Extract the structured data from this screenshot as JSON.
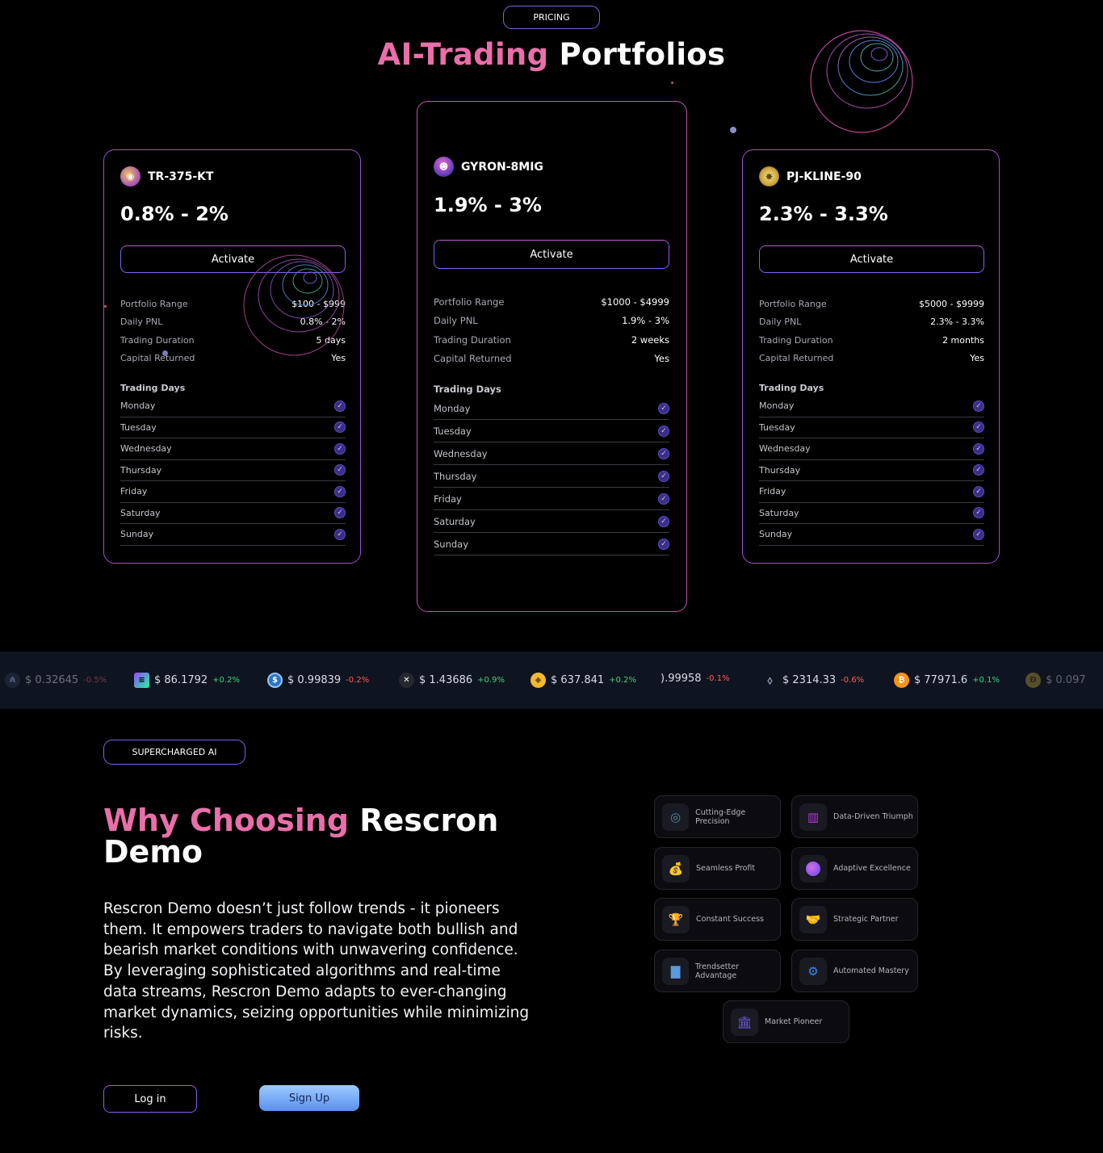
{
  "pricing": {
    "pill": "PRICING",
    "heading_accent": "AI-Trading",
    "heading_rest": "Portfolios"
  },
  "cards": [
    {
      "name": "TR-375-KT",
      "rate": "0.8% - 2%",
      "activate_label": "Activate",
      "details": [
        {
          "k": "Portfolio Range",
          "v": "$100 - $999"
        },
        {
          "k": "Daily PNL",
          "v": "0.8% - 2%"
        },
        {
          "k": "Trading Duration",
          "v": "5 days"
        },
        {
          "k": "Capital Returned",
          "v": "Yes"
        }
      ]
    },
    {
      "name": "GYRON-8MIG",
      "rate": "1.9% - 3%",
      "activate_label": "Activate",
      "details": [
        {
          "k": "Portfolio Range",
          "v": "$1000 - $4999"
        },
        {
          "k": "Daily PNL",
          "v": "1.9% - 3%"
        },
        {
          "k": "Trading Duration",
          "v": "2 weeks"
        },
        {
          "k": "Capital Returned",
          "v": "Yes"
        }
      ]
    },
    {
      "name": "PJ-KLINE-90",
      "rate": "2.3% - 3.3%",
      "activate_label": "Activate",
      "details": [
        {
          "k": "Portfolio Range",
          "v": "$5000 - $9999"
        },
        {
          "k": "Daily PNL",
          "v": "2.3% - 3.3%"
        },
        {
          "k": "Trading Duration",
          "v": "2 months"
        },
        {
          "k": "Capital Returned",
          "v": "Yes"
        }
      ]
    }
  ],
  "trading_days_title": "Trading Days",
  "days": [
    "Monday",
    "Tuesday",
    "Wednesday",
    "Thursday",
    "Friday",
    "Saturday",
    "Sunday"
  ],
  "ticker": [
    {
      "price": "$ 0.32645",
      "change": "-0.5%",
      "dir": "down",
      "icon": "ada-icon"
    },
    {
      "price": "$ 86.1792",
      "change": "+0.2%",
      "dir": "up",
      "icon": "solana-icon"
    },
    {
      "price": "$ 0.99839",
      "change": "-0.2%",
      "dir": "down",
      "icon": "usdc-icon"
    },
    {
      "price": "$ 1.43686",
      "change": "+0.9%",
      "dir": "up",
      "icon": "xrp-icon"
    },
    {
      "price": "$ 637.841",
      "change": "+0.2%",
      "dir": "up",
      "icon": "bnb-icon"
    },
    {
      "price": ").99958",
      "change": "-0.1%",
      "dir": "down",
      "icon": "usdt-icon"
    },
    {
      "price": "$ 2314.33",
      "change": "-0.6%",
      "dir": "down",
      "icon": "ethereum-icon"
    },
    {
      "price": "$ 77971.6",
      "change": "+0.1%",
      "dir": "up",
      "icon": "bitcoin-icon"
    },
    {
      "price": "$ 0.097",
      "change": "",
      "dir": "up",
      "icon": "doge-icon"
    }
  ],
  "why": {
    "pill": "SUPERCHARGED AI",
    "title_accent": "Why Choosing",
    "title_rest": "Rescron Demo",
    "body": "Rescron Demo doesn’t just follow trends - it pioneers them. It empowers traders to navigate both bullish and bearish market conditions with unwavering confidence. By leveraging sophisticated algorithms and real-time data streams, Rescron Demo adapts to ever-changing market dynamics, seizing opportunities while minimizing risks.",
    "login_label": "Log in",
    "signup_label": "Sign Up"
  },
  "features": [
    {
      "label": "Cutting-Edge Precision",
      "icon": "target-icon"
    },
    {
      "label": "Data-Driven Triumph",
      "icon": "chart-icon"
    },
    {
      "label": "Seamless Profit",
      "icon": "money-bag-icon"
    },
    {
      "label": "Adaptive Excellence",
      "icon": "orb-icon"
    },
    {
      "label": "Constant Success",
      "icon": "trophy-icon"
    },
    {
      "label": "Strategic Partner",
      "icon": "handshake-icon"
    },
    {
      "label": "Trendsetter Advantage",
      "icon": "bar-chart-icon"
    },
    {
      "label": "Automated Mastery",
      "icon": "robot-icon"
    },
    {
      "label": "Market Pioneer",
      "icon": "monument-icon"
    }
  ]
}
